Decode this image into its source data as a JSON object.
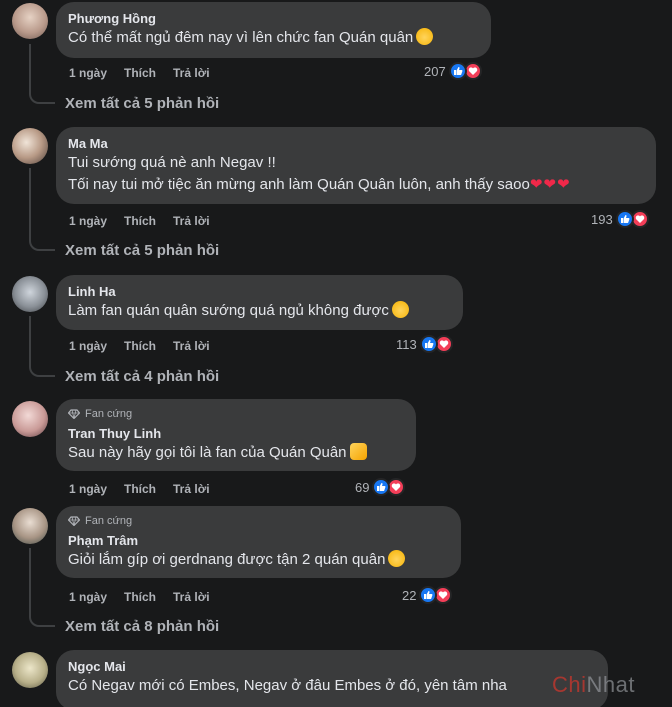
{
  "comments": [
    {
      "name": "Phương Hồng",
      "badge": "",
      "lines": [
        "Có thể mất ngủ đêm nay vì lên chức fan Quán quân"
      ],
      "time": "1 ngày",
      "like": "Thích",
      "reply": "Trả lời",
      "reactions": "207",
      "replies": "Xem tất cả 5 phản hồi"
    },
    {
      "name": "Ma Ma",
      "badge": "",
      "lines": [
        "Tui sướng quá nè anh Negav !!",
        "Tối nay tui mở tiệc ăn mừng anh làm Quán Quân luôn, anh thấy saoo"
      ],
      "time": "1 ngày",
      "like": "Thích",
      "reply": "Trả lời",
      "reactions": "193",
      "replies": "Xem tất cả 5 phản hồi"
    },
    {
      "name": "Linh Ha",
      "badge": "",
      "lines": [
        "Làm fan quán quân sướng quá ngủ không được"
      ],
      "time": "1 ngày",
      "like": "Thích",
      "reply": "Trả lời",
      "reactions": "113",
      "replies": "Xem tất cả 4 phản hồi"
    },
    {
      "name": "Tran Thuy Linh",
      "badge": "Fan cứng",
      "lines": [
        "Sau này hãy gọi tôi là fan của Quán Quân"
      ],
      "time": "1 ngày",
      "like": "Thích",
      "reply": "Trả lời",
      "reactions": "69",
      "replies": ""
    },
    {
      "name": "Phạm Trâm",
      "badge": "Fan cứng",
      "lines": [
        "Giỏi lắm gíp ơi gerdnang được tận 2 quán quân"
      ],
      "time": "1 ngày",
      "like": "Thích",
      "reply": "Trả lời",
      "reactions": "22",
      "replies": "Xem tất cả 8 phản hồi"
    },
    {
      "name": "Ngọc Mai",
      "badge": "",
      "lines": [
        "Có Negav mới có Embes, Negav ở đâu Embes ở đó, yên tâm nha"
      ],
      "time": "",
      "like": "",
      "reply": "",
      "reactions": "",
      "replies": ""
    }
  ],
  "hearts": "❤❤❤",
  "watermark": {
    "red": "Chi",
    "gray": "Nhat"
  },
  "colors": {
    "like": "#1877f2",
    "love": "#f33e58",
    "bubble": "#3a3b3c",
    "background": "#18191a"
  },
  "icons": [
    "like-icon",
    "love-icon",
    "diamond-icon",
    "emoji-icon"
  ]
}
